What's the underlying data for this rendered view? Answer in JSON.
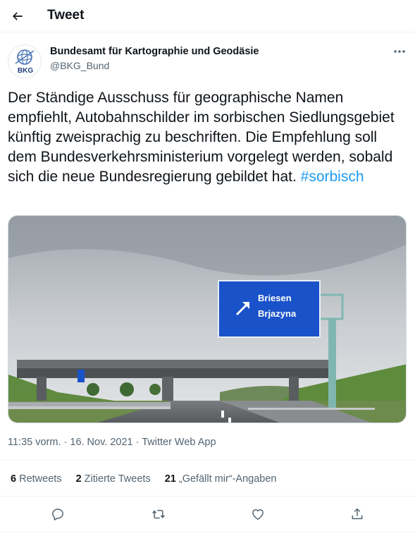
{
  "header": {
    "title": "Tweet"
  },
  "author": {
    "name": "Bundesamt für Kartographie und Geodäsie",
    "handle": "@BKG_Bund",
    "avatar_text": "BKG"
  },
  "tweet": {
    "text": "Der Ständige Ausschuss für geographische Namen empfiehlt, Autobahnschilder im sorbischen Siedlungsgebiet künftig zweisprachig zu beschriften. Die Empfehlung soll dem Bundesverkehrsministerium vorgelegt werden, sobald sich die neue Bundesregierung gebildet hat.",
    "hashtag": "#sorbisch"
  },
  "media": {
    "sign_line1": "Briesen",
    "sign_line2": "Brjazyna"
  },
  "meta": {
    "time": "11:35 vorm. · 16. Nov. 2021 · Twitter Web App"
  },
  "stats": {
    "retweets_count": "6",
    "retweets_label": "Retweets",
    "quotes_count": "2",
    "quotes_label": "Zitierte Tweets",
    "likes_count": "21",
    "likes_label": "„Gefällt mir“-Angaben"
  },
  "colors": {
    "accent": "#1d9bf0",
    "text": "#0f1419",
    "muted": "#536471",
    "sign_blue": "#1a52c9"
  },
  "icons": [
    "back-arrow-icon",
    "more-icon",
    "reply-icon",
    "retweet-icon",
    "like-icon",
    "share-icon"
  ]
}
